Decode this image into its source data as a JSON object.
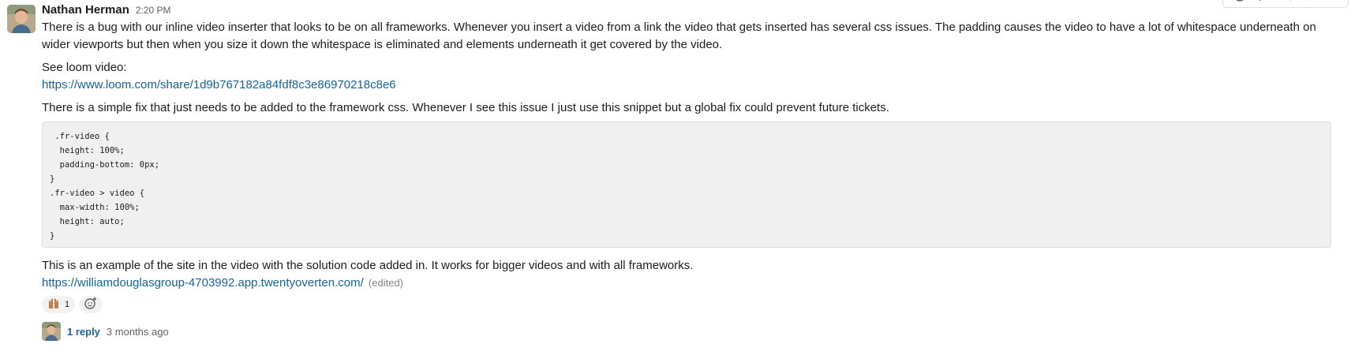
{
  "message": {
    "author": "Nathan Herman",
    "timestamp": "2:20 PM",
    "paragraph1": "There is a bug with our inline video inserter that looks to be on all frameworks. Whenever you insert a video from a link the video that gets inserted has several css issues. The padding causes the video to have a lot of whitespace underneath on wider viewports but then when you size it down the whitespace is eliminated and elements underneath it get covered by the video.",
    "see_loom": "See loom video:",
    "loom_link": "https://www.loom.com/share/1d9b767182a84fdf8c3e86970218c8e6",
    "paragraph3": "There is a simple fix that just needs to be added to the framework css. Whenever I see this issue I just use this snippet but a global fix could prevent future tickets.",
    "code": " .fr-video {\n  height: 100%;\n  padding-bottom: 0px;\n}\n.fr-video > video {\n  max-width: 100%;\n  height: auto;\n}",
    "paragraph4": "This is an example of the site in the video with the solution code added in. It works for bigger videos and with all frameworks.",
    "site_link": "https://williamdouglasgroup-4703992.app.twentyoverten.com/",
    "edited": "(edited)"
  },
  "reactions": [
    {
      "icon": "raised-hands-icon",
      "count": "1"
    }
  ],
  "thread": {
    "reply_count": "1 reply",
    "last_reply": "3 months ago"
  },
  "colors": {
    "link": "#1264a3",
    "text": "#1d1c1d",
    "muted": "#616061",
    "code_bg": "#f0f0f0"
  }
}
